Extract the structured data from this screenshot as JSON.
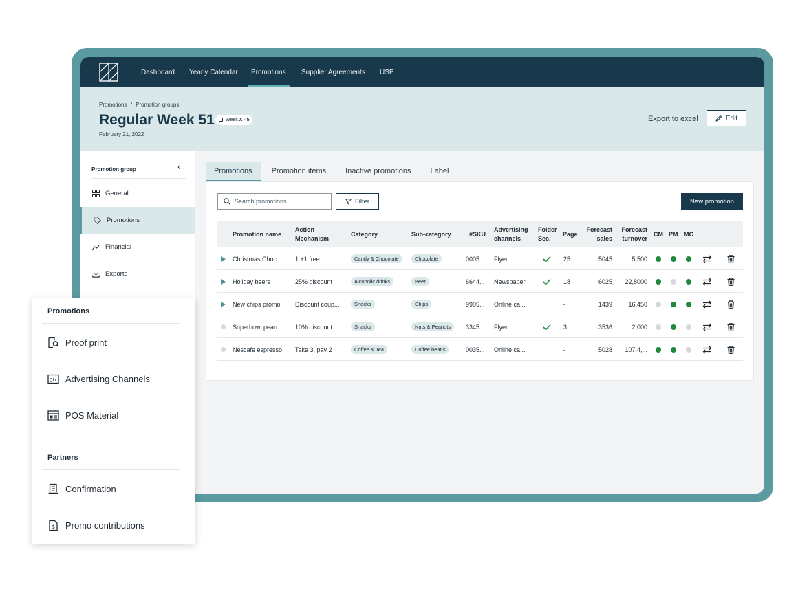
{
  "nav": {
    "items": [
      {
        "label": "Dashboard"
      },
      {
        "label": "Yearly Calendar"
      },
      {
        "label": "Promotions"
      },
      {
        "label": "Supplier Agreements"
      },
      {
        "label": "USP"
      }
    ],
    "active": "Promotions"
  },
  "header": {
    "breadcrumb_1": "Promotions",
    "breadcrumb_sep": "/",
    "breadcrumb_2": "Promotion groups",
    "title": "Regular Week 51",
    "week_badge_prefix": "Week",
    "week_badge_value": "X - 5",
    "date": "February 21, 2022",
    "export_label": "Export to excel",
    "edit_label": "Edit"
  },
  "sidebar": {
    "heading": "Promotion group",
    "collapse_icon": "chevron-left-icon",
    "items": [
      {
        "label": "General",
        "icon": "grid-icon"
      },
      {
        "label": "Promotions",
        "icon": "tag-icon"
      },
      {
        "label": "Financial",
        "icon": "trend-icon"
      },
      {
        "label": "Exports",
        "icon": "download-icon"
      }
    ],
    "active": "Promotions"
  },
  "tabs": [
    {
      "label": "Promotions"
    },
    {
      "label": "Promotion items"
    },
    {
      "label": "Inactive promotions"
    },
    {
      "label": "Label"
    }
  ],
  "toolbar": {
    "search_placeholder": "Search promotions",
    "filter_label": "Filter",
    "new_label": "New promotion"
  },
  "table": {
    "columns": {
      "name": "Promotion name",
      "action_1": "Action",
      "action_2": "Mechanism",
      "category": "Category",
      "subcategory": "Sub-category",
      "sku": "#SKU",
      "channels_1": "Advertising",
      "channels_2": "channels",
      "folder_1": "Folder",
      "folder_2": "Sec.",
      "page": "Page",
      "sales_1": "Forecast",
      "sales_2": "sales",
      "turnover_1": "Forecast",
      "turnover_2": "turnover",
      "cm": "CM",
      "pm": "PM",
      "mc": "MC"
    },
    "rows": [
      {
        "expandable": true,
        "name": "Christmas Choc...",
        "mechanism": "1 +1 free",
        "category": "Candy & Chocolate",
        "subcategory": "Chocolate",
        "sku": "0005...",
        "channels": "Flyer",
        "folder": true,
        "page": "25",
        "sales": "5045",
        "turnover": "5,500",
        "cm": "green",
        "pm": "green",
        "mc": "green"
      },
      {
        "expandable": true,
        "name": "Holiday beers",
        "mechanism": "25% discount",
        "category": "Alcoholic drinks",
        "subcategory": "Beer",
        "sku": "6644...",
        "channels": "Newspaper",
        "folder": true,
        "page": "18",
        "sales": "6025",
        "turnover": "22,8000",
        "cm": "green",
        "pm": "grey",
        "mc": "green"
      },
      {
        "expandable": true,
        "name": "New chips promo",
        "mechanism": "Discount coup...",
        "category": "Snacks",
        "subcategory": "Chips",
        "sku": "9905...",
        "channels": "Online ca...",
        "folder": false,
        "page": "-",
        "sales": "1439",
        "turnover": "16,450",
        "cm": "grey",
        "pm": "green",
        "mc": "green"
      },
      {
        "expandable": false,
        "name": "Superbowl pean...",
        "mechanism": "10% discount",
        "category": "Snacks",
        "subcategory": "Nuts & Peanuts",
        "sku": "3345...",
        "channels": "Flyer",
        "folder": true,
        "page": "3",
        "sales": "3536",
        "turnover": "2,000",
        "cm": "grey",
        "pm": "green",
        "mc": "grey"
      },
      {
        "expandable": false,
        "name": "Nescafe espresso",
        "mechanism": "Take 3, pay 2",
        "category": "Coffee & Tea",
        "subcategory": "Coffee beans",
        "sku": "0035...",
        "channels": "Online ca...",
        "folder": false,
        "page": "-",
        "sales": "5028",
        "turnover": "107,4,...",
        "cm": "green",
        "pm": "green",
        "mc": "grey"
      }
    ]
  },
  "popup": {
    "section_1": "Promotions",
    "items_1": [
      {
        "label": "Proof print",
        "icon": "proof-print-icon"
      },
      {
        "label": "Advertising Channels",
        "icon": "advertising-channels-icon"
      },
      {
        "label": "POS Material",
        "icon": "pos-material-icon"
      }
    ],
    "section_2": "Partners",
    "items_2": [
      {
        "label": "Confirmation",
        "icon": "confirmation-icon"
      },
      {
        "label": "Promo contributions",
        "icon": "promo-contributions-icon"
      }
    ]
  },
  "colors": {
    "navy": "#17394b",
    "teal": "#5b9aa0",
    "light_teal": "#dbe8e9",
    "status_green": "#1f8a3b",
    "status_grey": "#d5d9dc"
  }
}
